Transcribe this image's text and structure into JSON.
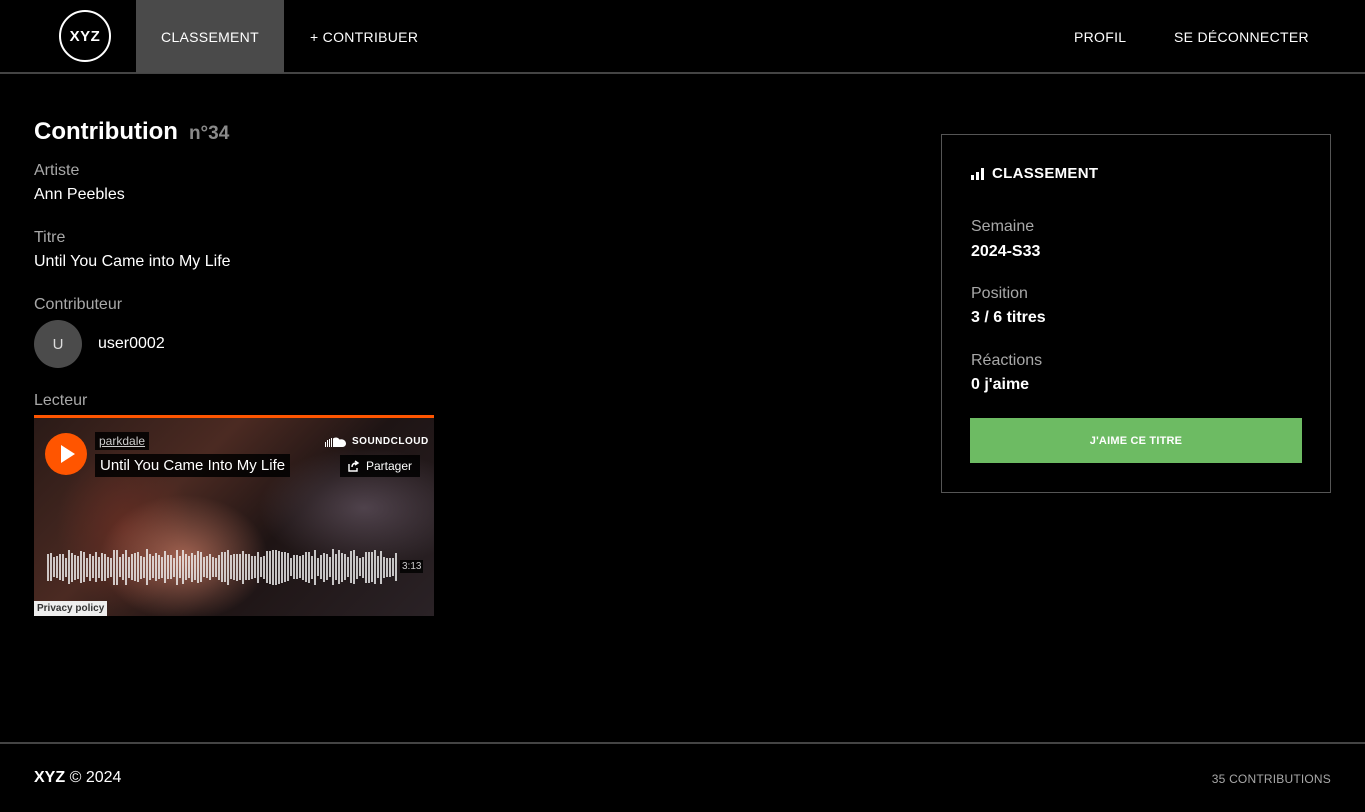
{
  "nav": {
    "logo": "XYZ",
    "classement": "CLASSEMENT",
    "contribuer": "+ CONTRIBUER",
    "profil": "PROFIL",
    "logout": "SE DÉCONNECTER"
  },
  "contribution": {
    "title": "Contribution",
    "number": "n°34",
    "artist_label": "Artiste",
    "artist": "Ann Peebles",
    "title_label": "Titre",
    "track_title": "Until You Came into My Life",
    "contributor_label": "Contributeur",
    "avatar_initial": "U",
    "contributor": "user0002",
    "player_label": "Lecteur"
  },
  "player": {
    "uploader": "parkdale",
    "track": "Until You Came Into My Life",
    "brand": "SOUNDCLOUD",
    "share": "Partager",
    "duration": "3:13",
    "privacy": "Privacy policy",
    "accent_color": "#ff5500"
  },
  "ranking": {
    "heading": "CLASSEMENT",
    "heading_icon": "bar-chart-icon",
    "week_label": "Semaine",
    "week": "2024-S33",
    "position_label": "Position",
    "position": "3 / 6 titres",
    "reactions_label": "Réactions",
    "reactions": "0 j'aime",
    "like_button": "J'AIME CE TITRE",
    "like_color": "#6dbb63"
  },
  "footer": {
    "brand": "XYZ",
    "copyright": "© 2024",
    "count": "35 CONTRIBUTIONS"
  }
}
